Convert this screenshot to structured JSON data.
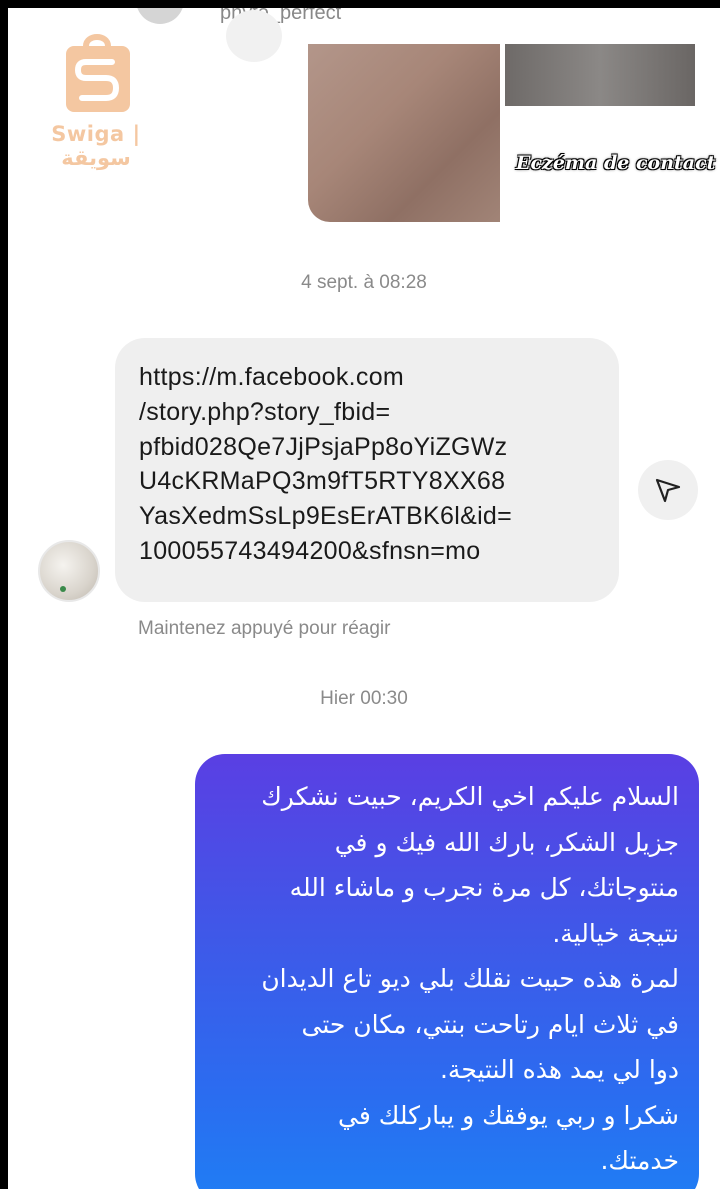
{
  "header": {
    "username": "phyto_perfect"
  },
  "watermark": {
    "text": "Swiga | سويقة",
    "color": "#f4c7a1"
  },
  "photo": {
    "caption": "Eczéma de contact"
  },
  "timestamps": {
    "first": "4 sept. à 08:28",
    "second": "Hier 00:30"
  },
  "received_message": {
    "lines": [
      "https://m.facebook.com",
      "/story.php?story_fbid=",
      "pfbid028Qe7JjPsjaPp8oYiZGWz",
      "U4cKRMaPQ3m9fT5RTY8XX68",
      "YasXedmSsLp9EsErATBK6l&id=",
      "100055743494200&sfnsn=mo"
    ],
    "hint": "Maintenez appuyé pour réagir"
  },
  "sent_message": {
    "lines": [
      "السلام عليكم اخي الكريم، حبيت نشكرك",
      "جزيل الشكر، بارك الله فيك و في",
      "منتوجاتك، كل مرة نجرب و ماشاء الله",
      "نتيجة خيالية.",
      "لمرة هذه حبيت نقلك بلي ديو تاع الديدان",
      "في ثلاث ايام رتاحت بنتي، مكان حتى",
      "دوا لي يمد هذه النتيجة.",
      "شكرا و ربي يوفقك و يباركلك في",
      "خدمتك."
    ],
    "gradient": [
      "#5a3fe3",
      "#1f7ef4"
    ]
  },
  "icons": {
    "share": "send-icon",
    "logo": "shopping-bag-icon"
  }
}
